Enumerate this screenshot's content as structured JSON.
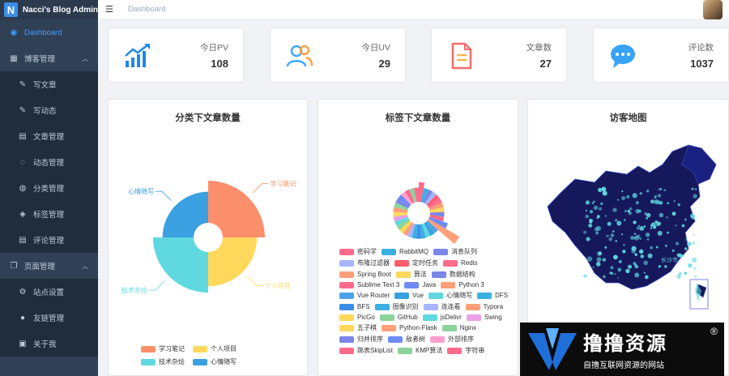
{
  "app": {
    "title": "Nacci's Blog Admin",
    "logo_letter": "N"
  },
  "sidebar": {
    "items": [
      {
        "label": "Dashboard",
        "icon": "dashboard-icon",
        "active": true
      },
      {
        "label": "博客管理",
        "icon": "grid-icon"
      },
      {
        "label": "写文章",
        "icon": "pen-icon"
      },
      {
        "label": "写动态",
        "icon": "pen-icon"
      },
      {
        "label": "文章管理",
        "icon": "document-icon"
      },
      {
        "label": "动态管理",
        "icon": "chat-icon"
      },
      {
        "label": "分类管理",
        "icon": "bulb-icon"
      },
      {
        "label": "标签管理",
        "icon": "tag-icon"
      },
      {
        "label": "评论管理",
        "icon": "comment-icon"
      },
      {
        "label": "页面管理",
        "icon": "copy-icon"
      },
      {
        "label": "站点设置",
        "icon": "settings-icon"
      },
      {
        "label": "友链管理",
        "icon": "user-icon"
      },
      {
        "label": "关于我",
        "icon": "image-icon"
      }
    ]
  },
  "topbar": {
    "breadcrumb": "Dashboard"
  },
  "stats": [
    {
      "label": "今日PV",
      "value": "108",
      "icon": "trend-up-icon",
      "color": "#1e88e5"
    },
    {
      "label": "今日UV",
      "value": "29",
      "icon": "users-icon",
      "color": "#40a9ff"
    },
    {
      "label": "文章数",
      "value": "27",
      "icon": "article-icon",
      "color": "#f56c6c"
    },
    {
      "label": "评论数",
      "value": "1037",
      "icon": "chat-bubble-icon",
      "color": "#36a3f7"
    }
  ],
  "panels": {
    "category": "分类下文章数量",
    "tag": "标签下文章数量",
    "map": "访客地图"
  },
  "chart_data": [
    {
      "type": "pie",
      "title": "分类下文章数量",
      "rose": true,
      "labels": [
        "学习笔记",
        "个人项目",
        "技术杂烩",
        "心情随写"
      ],
      "values": [
        12,
        7,
        11,
        5
      ],
      "colors": [
        "#fc8f6b",
        "#ffd85c",
        "#5fd8e0",
        "#3aa0e0"
      ]
    },
    {
      "type": "pie",
      "title": "标签下文章数量",
      "rose": true,
      "labels": [
        "密码学",
        "RabbitMQ",
        "消息队列",
        "布隆过滤器",
        "定时任务",
        "Redis",
        "Spring Boot",
        "算法",
        "数据结构",
        "Sublime Text 3",
        "Java",
        "Python 3",
        "Vue Router",
        "Vue",
        "心情随写",
        "DFS",
        "BFS",
        "图像识别",
        "连连看",
        "Typora",
        "PicGo",
        "GitHub",
        "jsDelivr",
        "Swing",
        "五子棋",
        "Python-Flask",
        "Nginx",
        "归并排序",
        "敌者树",
        "外部排序",
        "跳表SkipList",
        "KMP算法",
        "字符串"
      ],
      "values": [
        2,
        1,
        1,
        1,
        1,
        1,
        1,
        1,
        1,
        1,
        2,
        5,
        1,
        1,
        1,
        1,
        1,
        1,
        1,
        1,
        1,
        1,
        1,
        1,
        1,
        1,
        1,
        1,
        1,
        1,
        1,
        1,
        1
      ],
      "colors": [
        "#ff6b8b",
        "#3ab0e0",
        "#7a86e8",
        "#a7b4ff",
        "#ff5c6c",
        "#ff6b8b",
        "#ff9f7a",
        "#ffd85c",
        "#7a86e8",
        "#ff6b8b",
        "#6d8bf5",
        "#ff9f7a",
        "#4aa3e8",
        "#3aa0e0",
        "#5fd8e0",
        "#3ab0e0",
        "#3a8ee6",
        "#3ab0e0",
        "#a7b4ff",
        "#ff9f7a",
        "#ffd85c",
        "#8bd39b",
        "#5fd8e0",
        "#e8a0e8",
        "#ffd85c",
        "#ff9f7a",
        "#8bd39b",
        "#7a86e8",
        "#6d8bf5",
        "#ff9fd0",
        "#ff6b8b",
        "#8bd39b",
        "#ff6b8b"
      ]
    }
  ],
  "map": {
    "highlight_label": "长沙市"
  },
  "watermark": {
    "main": "撸撸资源",
    "registered": "®",
    "sub": "自撸互联网资源的网站"
  }
}
